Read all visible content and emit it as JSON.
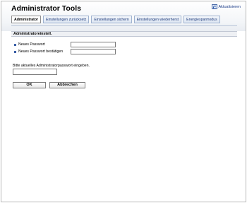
{
  "header": {
    "title": "Administrator Tools",
    "refresh_label": "Aktualisieren"
  },
  "tabs": [
    {
      "label": "Administrator",
      "active": true
    },
    {
      "label": "Einstellungen zurücksetz",
      "active": false
    },
    {
      "label": "Einstellungen sichern",
      "active": false
    },
    {
      "label": "Einstellungen wiederherst",
      "active": false
    },
    {
      "label": "Energiesparmodus",
      "active": false
    }
  ],
  "section": {
    "title": "Administratoreinstell."
  },
  "form": {
    "new_password_label": "Neues Passwort",
    "confirm_password_label": "Neues Passwort bestätigen",
    "new_password_value": "",
    "confirm_password_value": ""
  },
  "current_password": {
    "prompt": "Bitte aktuelles Administratorpasswort eingeben.",
    "value": ""
  },
  "buttons": {
    "ok": "OK",
    "cancel": "Abbrechen"
  },
  "colors": {
    "tab_border": "#9fb2cf",
    "bullet": "#3a5fa6",
    "link": "#1f3f8a"
  }
}
